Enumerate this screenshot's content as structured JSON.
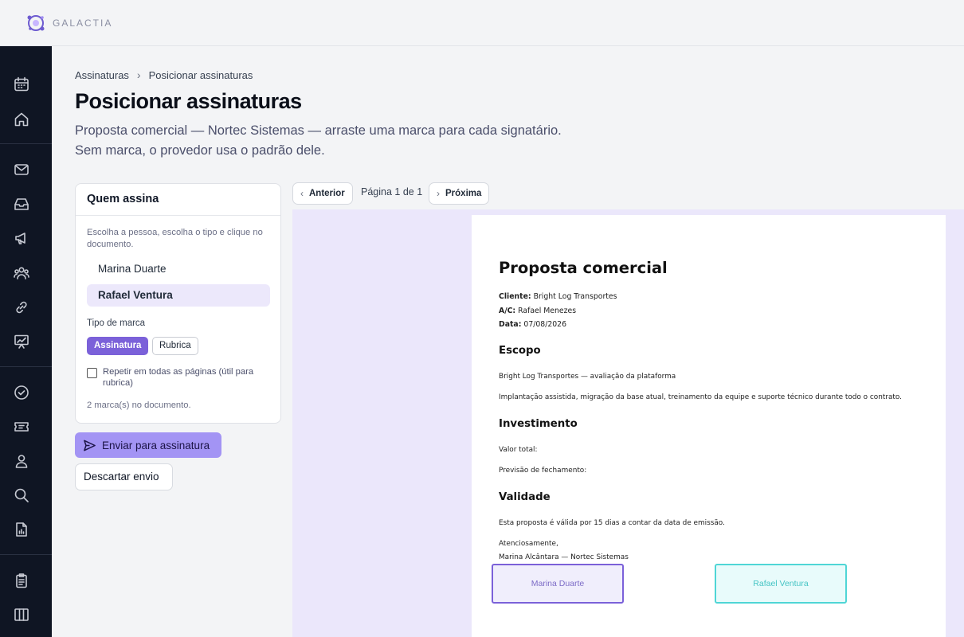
{
  "app": {
    "brand": "GALACTIA"
  },
  "breadcrumb": {
    "root": "Assinaturas",
    "separator": "›",
    "current": "Posicionar assinaturas"
  },
  "page": {
    "title": "Posicionar assinaturas",
    "subtitle": "Proposta comercial — Nortec Sistemas — arraste uma marca para cada signatário. Sem marca, o provedor usa o padrão dele."
  },
  "panel": {
    "title": "Quem assina",
    "hint": "Escolha a pessoa, escolha o tipo e clique no documento.",
    "signers": [
      {
        "name": "Marina Duarte",
        "selected": false
      },
      {
        "name": "Rafael Ventura",
        "selected": true
      }
    ],
    "mark_type_label": "Tipo de marca",
    "mark_types": [
      {
        "label": "Assinatura",
        "active": true
      },
      {
        "label": "Rubrica",
        "active": false
      }
    ],
    "repeat_label": "Repetir em todas as páginas (útil para rubrica)",
    "repeat_checked": false,
    "count_text": "2 marca(s) no documento."
  },
  "actions": {
    "send": "Enviar para assinatura",
    "discard": "Descartar envio"
  },
  "pager": {
    "prev": "Anterior",
    "info": "Página 1 de 1",
    "next": "Próxima"
  },
  "document": {
    "title": "Proposta comercial",
    "client_label": "Cliente:",
    "client": "Bright Log Transportes",
    "ac_label": "A/C:",
    "ac": "Rafael Menezes",
    "date_label": "Data:",
    "date": "07/08/2026",
    "scope_title": "Escopo",
    "scope_line1": "Bright Log Transportes — avaliação da plataforma",
    "scope_line2": "Implantação assistida, migração da base atual, treinamento da equipe e suporte técnico durante todo o contrato.",
    "invest_title": "Investimento",
    "total_label": "Valor total:",
    "forecast_label": "Previsão de fechamento:",
    "validity_title": "Validade",
    "validity_text": "Esta proposta é válida por 15 dias a contar da data de emissão.",
    "closing": "Atenciosamente,",
    "sender": "Marina Alcântara — Nortec Sistemas"
  },
  "marks": [
    {
      "signer": "Marina Duarte",
      "color": "#7b61d9"
    },
    {
      "signer": "Rafael Ventura",
      "color": "#4fd6d6"
    }
  ],
  "colors": {
    "accent": "#7b61d9",
    "send_button": "#a394f4",
    "sidebar": "#0f1523",
    "canvas": "#ebe7fb"
  },
  "sidebar_icons": [
    "calendar-icon",
    "home-icon",
    "mail-icon",
    "inbox-icon",
    "megaphone-icon",
    "users-icon",
    "link-icon",
    "chart-icon",
    "check-circle-icon",
    "ticket-icon",
    "user-icon",
    "search-icon",
    "report-icon",
    "clipboard-icon",
    "columns-icon"
  ]
}
